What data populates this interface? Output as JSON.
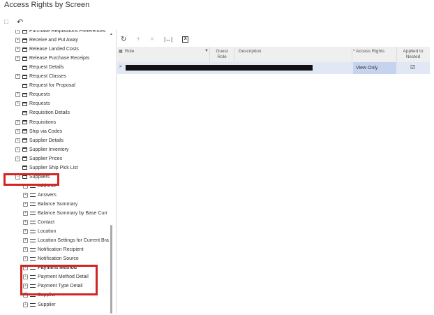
{
  "page": {
    "title": "Access Rights by Screen"
  },
  "toolbar": {
    "save_icon": "save-icon",
    "undo_icon": "undo-icon"
  },
  "tree": {
    "items": [
      {
        "label": "Purchase Requisitions Preferences",
        "kind": "screen",
        "expander": "+",
        "level": 1
      },
      {
        "label": "Receive and Put Away",
        "kind": "screen",
        "expander": "+",
        "level": 1
      },
      {
        "label": "Release Landed Costs",
        "kind": "screen",
        "expander": "+",
        "level": 1
      },
      {
        "label": "Release Purchase Receipts",
        "kind": "screen",
        "expander": "+",
        "level": 1
      },
      {
        "label": "Request Details",
        "kind": "screen",
        "expander": "",
        "level": 1
      },
      {
        "label": "Request Classes",
        "kind": "screen",
        "expander": "+",
        "level": 1
      },
      {
        "label": "Request for Proposal",
        "kind": "screen",
        "expander": "",
        "level": 1
      },
      {
        "label": "Requests",
        "kind": "screen",
        "expander": "+",
        "level": 1
      },
      {
        "label": "Requests",
        "kind": "screen",
        "expander": "+",
        "level": 1
      },
      {
        "label": "Requisition Details",
        "kind": "screen",
        "expander": "",
        "level": 1
      },
      {
        "label": "Requisitions",
        "kind": "screen",
        "expander": "+",
        "level": 1
      },
      {
        "label": "Ship via Codes",
        "kind": "screen",
        "expander": "+",
        "level": 1
      },
      {
        "label": "Supplier Details",
        "kind": "screen",
        "expander": "+",
        "level": 1
      },
      {
        "label": "Supplier Inventory",
        "kind": "screen",
        "expander": "+",
        "level": 1
      },
      {
        "label": "Supplier Prices",
        "kind": "screen",
        "expander": "+",
        "level": 1
      },
      {
        "label": "Supplier Ship Pick List",
        "kind": "screen",
        "expander": "",
        "level": 1
      },
      {
        "label": "Suppliers",
        "kind": "screen",
        "expander": "−",
        "level": 1
      },
      {
        "label": "Address",
        "kind": "field",
        "expander": "+",
        "level": 2
      },
      {
        "label": "Answers",
        "kind": "field",
        "expander": "+",
        "level": 2
      },
      {
        "label": "Balance Summary",
        "kind": "field",
        "expander": "+",
        "level": 2
      },
      {
        "label": "Balance Summary by Base Curr",
        "kind": "field",
        "expander": "+",
        "level": 2
      },
      {
        "label": "Contact",
        "kind": "field",
        "expander": "+",
        "level": 2
      },
      {
        "label": "Location",
        "kind": "field",
        "expander": "+",
        "level": 2
      },
      {
        "label": "Location Settings for Current Bra",
        "kind": "field",
        "expander": "+",
        "level": 2
      },
      {
        "label": "Notification Recipient",
        "kind": "field",
        "expander": "+",
        "level": 2
      },
      {
        "label": "Notification Source",
        "kind": "field",
        "expander": "+",
        "level": 2
      },
      {
        "label": "Payment Method",
        "kind": "field",
        "expander": "+",
        "level": 2,
        "bold": true
      },
      {
        "label": "Payment Method Detail",
        "kind": "field",
        "expander": "+",
        "level": 2
      },
      {
        "label": "Payment Type Detail",
        "kind": "field",
        "expander": "+",
        "level": 2
      },
      {
        "label": "Supplier",
        "kind": "field",
        "expander": "+",
        "level": 2
      },
      {
        "label": "Supplier",
        "kind": "field",
        "expander": "+",
        "level": 2
      }
    ]
  },
  "grid_toolbar": {
    "refresh": "↻",
    "add": "+",
    "delete": "×",
    "fit": "|↔|",
    "export": "X"
  },
  "grid": {
    "columns": {
      "role": "Role",
      "guest_role": "Guest Role",
      "description": "Description",
      "access_rights": "Access Rights",
      "applied": "Applied to Nested",
      "required_marker": "*"
    },
    "row": {
      "indicator": ">",
      "access_rights": "View Only",
      "applied_checked": "☑"
    }
  }
}
